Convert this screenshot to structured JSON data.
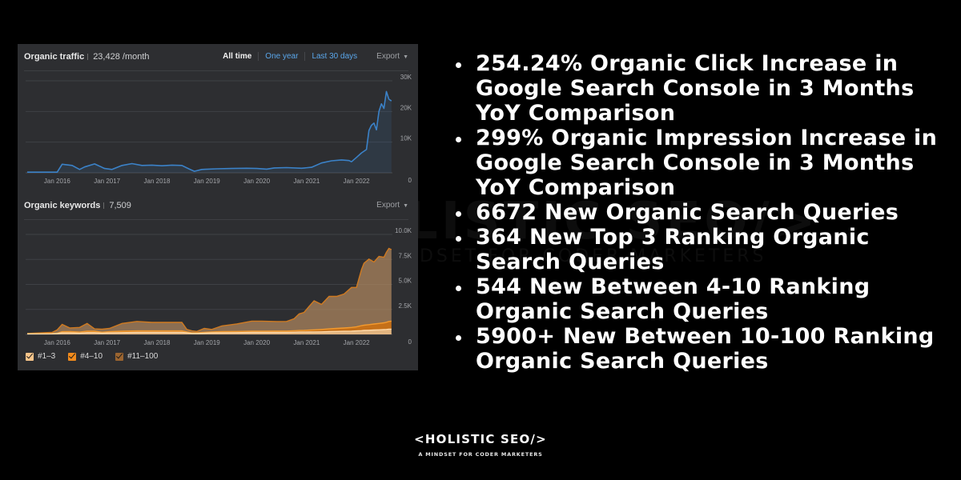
{
  "watermark": {
    "line1": "HOLISTIC SEO/>",
    "line2": "A MINDSET FOR CODER MARKETERS"
  },
  "traffic_panel": {
    "title": "Organic traffic",
    "value": "23,428 /month",
    "tabs": [
      {
        "label": "All time",
        "active": true
      },
      {
        "label": "One year",
        "active": false
      },
      {
        "label": "Last 30 days",
        "active": false
      }
    ],
    "export_label": "Export",
    "line_color": "#3b82c8"
  },
  "keywords_panel": {
    "title": "Organic keywords",
    "value": "7,509",
    "export_label": "Export",
    "legend": [
      {
        "label": "#1–3",
        "color": "#f6c48a"
      },
      {
        "label": "#4–10",
        "color": "#f08a1c"
      },
      {
        "label": "#11–100",
        "color": "#9a6430"
      }
    ]
  },
  "bullets": [
    "254.24% Organic Click Increase in Google Search Console in 3 Months YoY Comparison",
    "299% Organic Impression Increase in Google Search Console in 3 Months YoY Comparison",
    "6672 New Organic Search Queries",
    "364 New Top 3 Ranking Organic Search Queries",
    "544 New Between 4-10 Ranking Organic Search Queries",
    "5900+ New Between 10-100 Ranking Organic Search Queries"
  ],
  "footer": {
    "brand": "<HOLISTIC SEO/>",
    "tagline": "A MINDSET FOR CODER MARKETERS"
  },
  "chart_data": [
    {
      "type": "line",
      "title": "Organic traffic",
      "xlabel": "",
      "ylabel": "",
      "x_ticks": [
        "Jan 2016",
        "Jan 2017",
        "Jan 2018",
        "Jan 2019",
        "Jan 2020",
        "Jan 2021",
        "Jan 2022"
      ],
      "y_ticks": [
        "0",
        "10K",
        "20K",
        "30K"
      ],
      "ylim": [
        0,
        30000
      ],
      "xlim": [
        2015.4,
        2022.72
      ],
      "grid": true,
      "x": [
        2015.4,
        2015.9,
        2016.0,
        2016.1,
        2016.3,
        2016.45,
        2016.55,
        2016.75,
        2016.95,
        2017.1,
        2017.3,
        2017.5,
        2017.7,
        2017.9,
        2018.1,
        2018.3,
        2018.5,
        2018.65,
        2018.75,
        2018.9,
        2019.2,
        2019.5,
        2019.8,
        2020.0,
        2020.2,
        2020.35,
        2020.6,
        2020.9,
        2021.1,
        2021.3,
        2021.5,
        2021.7,
        2021.85,
        2021.9,
        2022.0,
        2022.1,
        2022.2,
        2022.25,
        2022.3,
        2022.35,
        2022.4,
        2022.45,
        2022.5,
        2022.55,
        2022.6,
        2022.65,
        2022.7
      ],
      "series": [
        {
          "name": "Organic traffic",
          "values": [
            200,
            200,
            200,
            2800,
            2400,
            1100,
            1900,
            2900,
            1400,
            1100,
            2400,
            3000,
            2400,
            2500,
            2300,
            2500,
            2400,
            1200,
            500,
            1100,
            1300,
            1400,
            1500,
            1400,
            1200,
            1600,
            1700,
            1500,
            1800,
            3200,
            3900,
            4200,
            4000,
            3600,
            5000,
            6500,
            7600,
            13800,
            15500,
            16200,
            14000,
            20000,
            22500,
            21000,
            26500,
            24000,
            23428
          ]
        }
      ]
    },
    {
      "type": "area",
      "title": "Organic keywords",
      "xlabel": "",
      "ylabel": "",
      "x_ticks": [
        "Jan 2016",
        "Jan 2017",
        "Jan 2018",
        "Jan 2019",
        "Jan 2020",
        "Jan 2021",
        "Jan 2022"
      ],
      "y_ticks": [
        "0",
        "2.5K",
        "5.0K",
        "7.5K",
        "10.0K"
      ],
      "ylim": [
        0,
        10000
      ],
      "xlim": [
        2015.4,
        2022.72
      ],
      "grid": true,
      "legend_position": "bottom-left",
      "stacked": true,
      "x": [
        2015.4,
        2015.9,
        2016.0,
        2016.1,
        2016.25,
        2016.45,
        2016.6,
        2016.75,
        2016.9,
        2017.05,
        2017.3,
        2017.6,
        2017.9,
        2018.2,
        2018.5,
        2018.6,
        2018.7,
        2018.8,
        2018.95,
        2019.1,
        2019.3,
        2019.6,
        2019.9,
        2020.1,
        2020.4,
        2020.6,
        2020.75,
        2020.85,
        2020.95,
        2021.05,
        2021.15,
        2021.3,
        2021.45,
        2021.6,
        2021.75,
        2021.9,
        2022.0,
        2022.1,
        2022.15,
        2022.25,
        2022.35,
        2022.45,
        2022.55,
        2022.6,
        2022.65,
        2022.7
      ],
      "series": [
        {
          "name": "#1–3",
          "values": [
            50,
            60,
            80,
            150,
            150,
            120,
            180,
            180,
            120,
            150,
            180,
            200,
            200,
            200,
            200,
            150,
            100,
            100,
            120,
            150,
            170,
            180,
            200,
            200,
            200,
            200,
            220,
            230,
            230,
            240,
            250,
            260,
            280,
            300,
            310,
            330,
            350,
            380,
            400,
            420,
            440,
            460,
            480,
            500,
            520,
            530
          ]
        },
        {
          "name": "#4–10",
          "values": [
            20,
            30,
            40,
            120,
            130,
            110,
            150,
            140,
            100,
            120,
            140,
            150,
            150,
            150,
            150,
            100,
            60,
            60,
            80,
            100,
            110,
            120,
            130,
            130,
            140,
            140,
            150,
            160,
            170,
            190,
            210,
            240,
            270,
            300,
            330,
            370,
            400,
            500,
            520,
            560,
            600,
            640,
            680,
            720,
            780,
            800
          ]
        },
        {
          "name": "#11–100",
          "values": [
            30,
            110,
            330,
            730,
            370,
            470,
            770,
            230,
            300,
            330,
            780,
            950,
            850,
            850,
            850,
            250,
            190,
            140,
            400,
            250,
            570,
            750,
            1000,
            1000,
            950,
            960,
            1200,
            1660,
            1800,
            2370,
            2900,
            2500,
            3250,
            3200,
            3400,
            4000,
            3950,
            5600,
            6200,
            6550,
            6200,
            6700,
            6550,
            7000,
            7300,
            7150
          ]
        }
      ]
    }
  ]
}
